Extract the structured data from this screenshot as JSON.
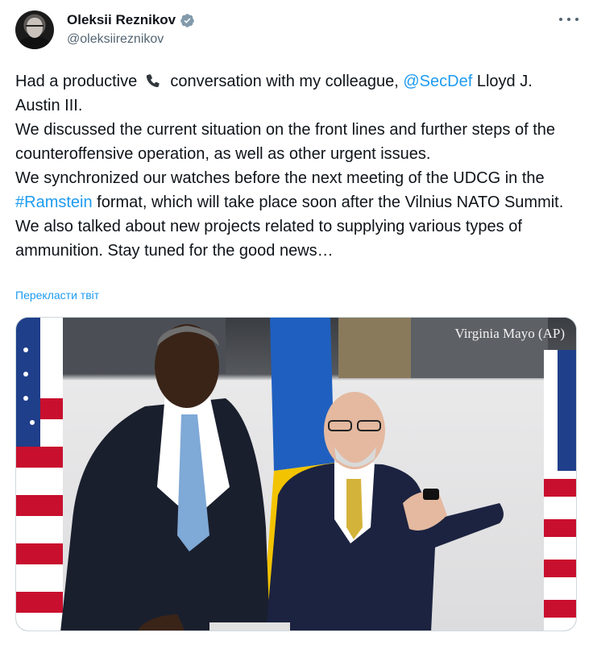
{
  "author": {
    "display_name": "Oleksii Reznikov",
    "handle": "@oleksiireznikov",
    "verified": true
  },
  "tweet": {
    "p1_before": "Had a productive",
    "p1_after": "conversation with my colleague,",
    "mention": "@SecDef",
    "p1_end": "Lloyd J. Austin III.",
    "p2": "We discussed the current situation on the front lines and further steps of the counteroffensive operation, as well as other urgent issues.",
    "p3_before": "We synchronized our watches before the next meeting of the UDCG in the",
    "hashtag": "#Ramstein",
    "p3_after": "format, which will take place soon after the Vilnius NATO Summit.",
    "p4": "We also talked about new projects related to supplying various types of ammunition. Stay tuned for the good news…"
  },
  "translate_label": "Перекласти твіт",
  "media": {
    "photo_credit": "Virginia Mayo (AP)"
  },
  "icons": {
    "verified": "verified-badge-icon",
    "more": "more-options-icon",
    "phone": "telephone-receiver-emoji"
  },
  "colors": {
    "link": "#1d9bf0",
    "verified_badge": "#829aab",
    "secondary_text": "#536471"
  }
}
